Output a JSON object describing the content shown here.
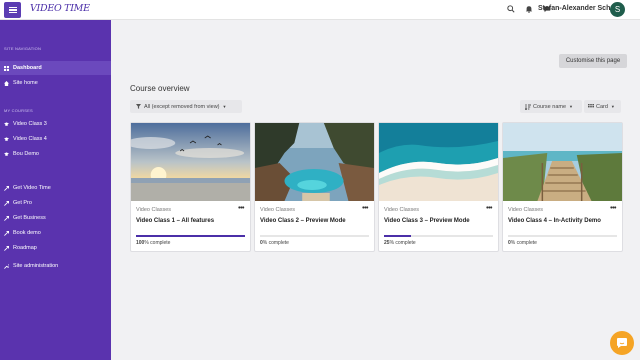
{
  "header": {
    "logo_text": "VIDEO TIME",
    "username": "Stefan-Alexander Scholz",
    "avatar_initial": "S"
  },
  "sidebar": {
    "nav_section": "SITE NAVIGATION",
    "courses_section": "MY COURSES",
    "items": [
      {
        "label": "Dashboard",
        "icon": "dashboard-icon"
      },
      {
        "label": "Site home",
        "icon": "home-icon"
      },
      {
        "label": "Video Class 3",
        "icon": "graduation-cap-icon"
      },
      {
        "label": "Video Class 4",
        "icon": "graduation-cap-icon"
      },
      {
        "label": "Bou Demo",
        "icon": "graduation-cap-icon"
      },
      {
        "label": "Get Video Time",
        "icon": "link-icon"
      },
      {
        "label": "Get Pro",
        "icon": "link-icon"
      },
      {
        "label": "Get Business",
        "icon": "link-icon"
      },
      {
        "label": "Book demo",
        "icon": "link-icon"
      },
      {
        "label": "Roadmap",
        "icon": "link-icon"
      },
      {
        "label": "Site administration",
        "icon": "wrench-icon"
      }
    ]
  },
  "main": {
    "customise_label": "Customise this page",
    "overview_title": "Course overview",
    "filter_label": "All (except removed from view)",
    "sort_label": "Course name",
    "view_label": "Card",
    "courses": [
      {
        "category": "Video Classes",
        "name": "Video Class 1 – All features",
        "progress": 100,
        "progress_text": "100",
        "suffix": "% complete"
      },
      {
        "category": "Video Classes",
        "name": "Video Class 2 – Preview Mode",
        "progress": 0,
        "progress_text": "0",
        "suffix": "% complete"
      },
      {
        "category": "Video Classes",
        "name": "Video Class 3 – Preview Mode",
        "progress": 25,
        "progress_text": "25",
        "suffix": "% complete"
      },
      {
        "category": "Video Classes",
        "name": "Video Class 4 – In-Activity Demo",
        "progress": 0,
        "progress_text": "0",
        "suffix": "% complete"
      }
    ],
    "menu_glyph": "•••"
  },
  "colors": {
    "sidebar": "#5a33ae",
    "accent": "#4b2fa8",
    "chat": "#f5a425"
  }
}
